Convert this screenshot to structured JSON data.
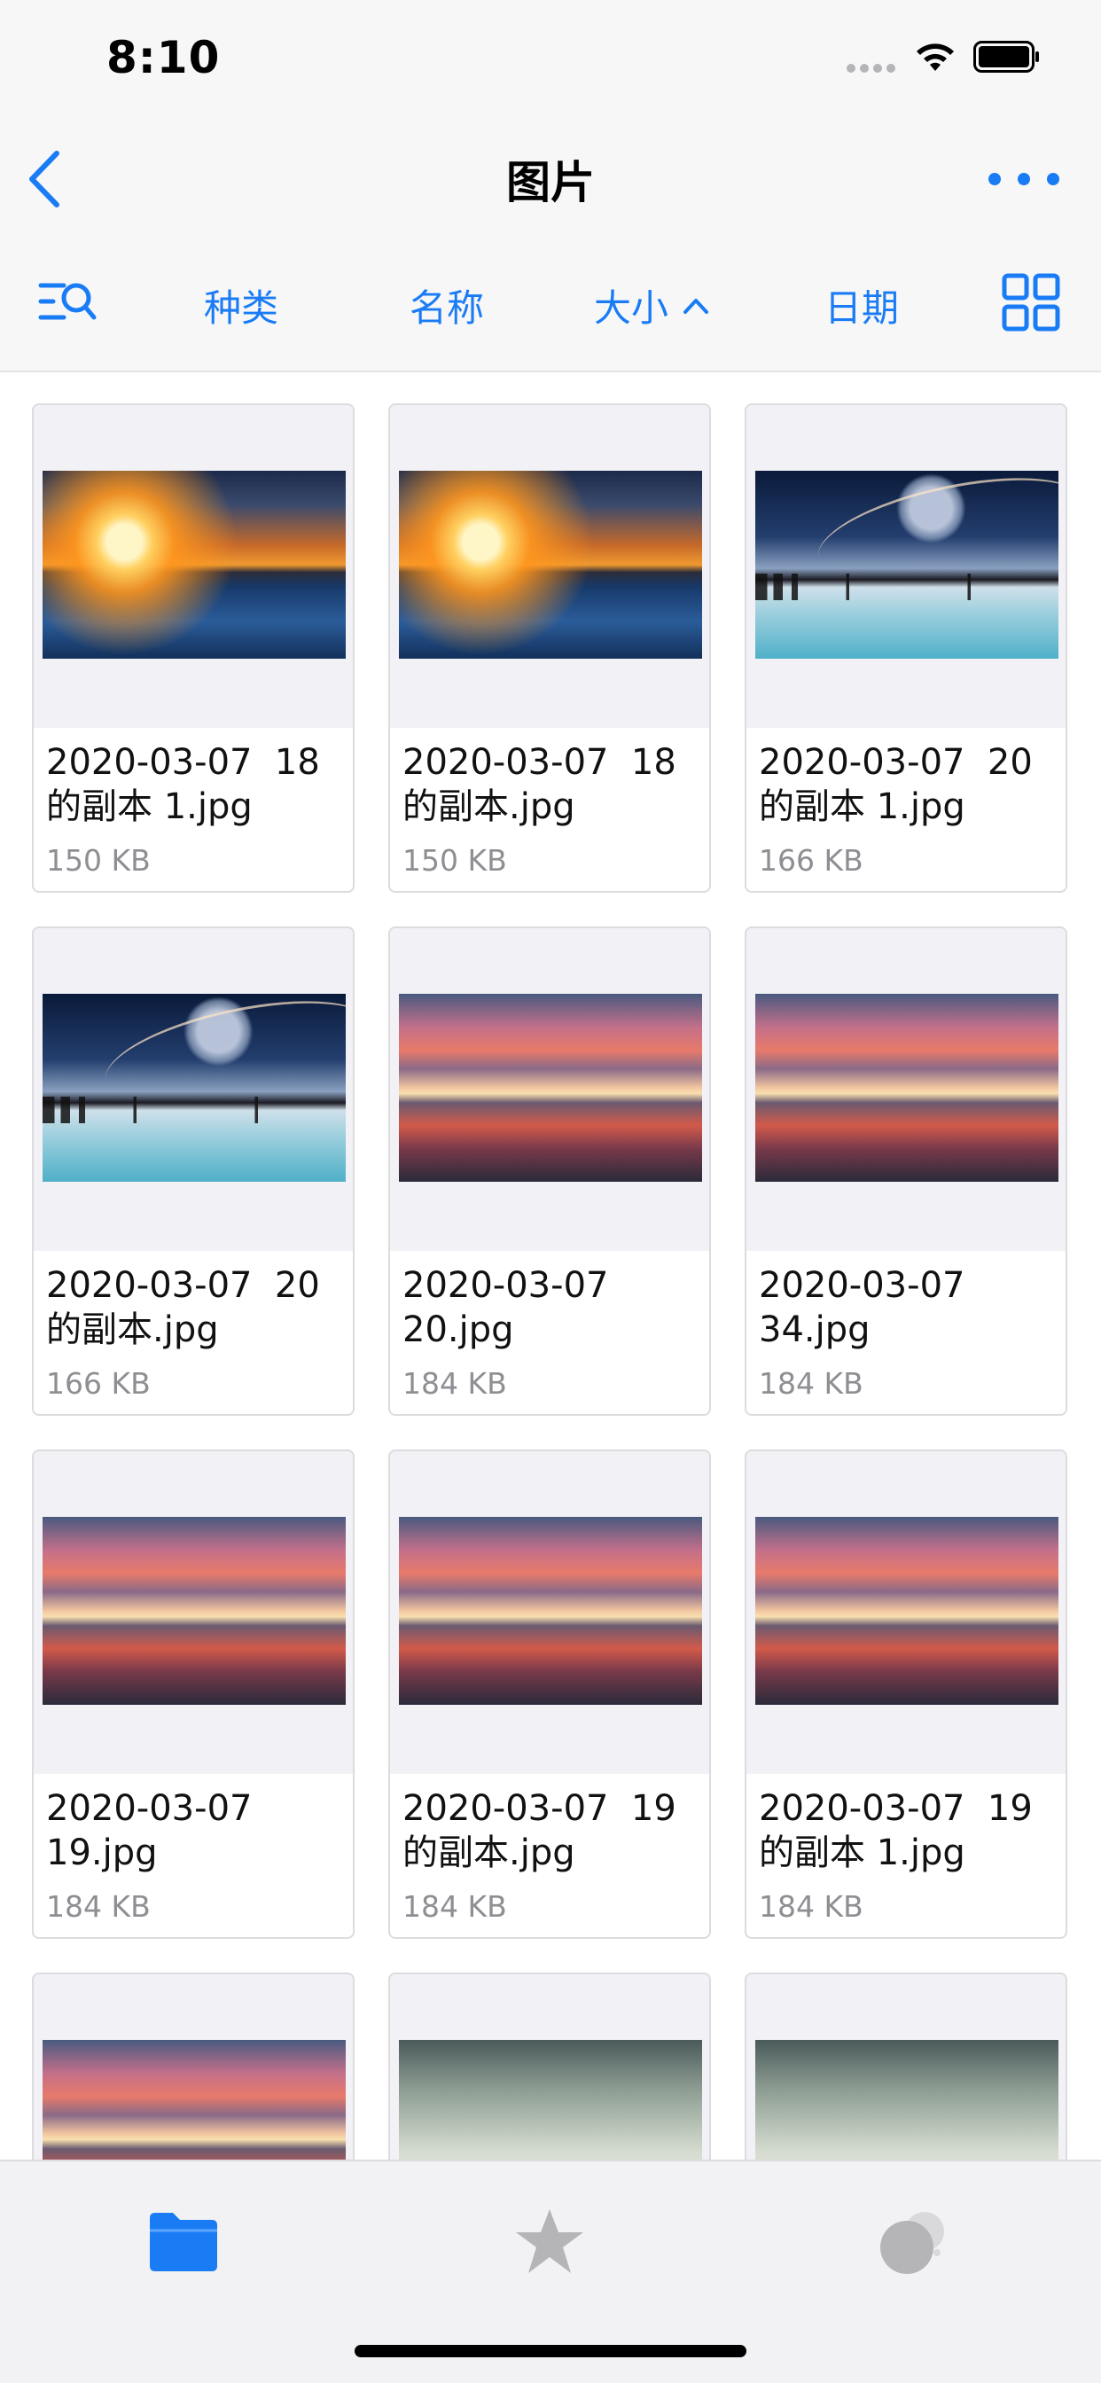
{
  "status_bar": {
    "time": "8:10"
  },
  "nav": {
    "title": "图片"
  },
  "sort_bar": {
    "options": [
      {
        "label": "种类"
      },
      {
        "label": "名称"
      },
      {
        "label": "大小"
      },
      {
        "label": "日期"
      }
    ],
    "active": "大小",
    "active_direction": "ascending"
  },
  "files": [
    {
      "name": "2020-03-07  18\n的副本 1.jpg",
      "size": "150 KB",
      "thumb": "sunset-orange"
    },
    {
      "name": "2020-03-07  18\n的副本.jpg",
      "size": "150 KB",
      "thumb": "sunset-orange"
    },
    {
      "name": "2020-03-07  20\n的副本 1.jpg",
      "size": "166 KB",
      "thumb": "planet-city"
    },
    {
      "name": "2020-03-07  20\n的副本.jpg",
      "size": "166 KB",
      "thumb": "planet-city"
    },
    {
      "name": "2020-03-07\n20.jpg",
      "size": "184 KB",
      "thumb": "pink-sunset"
    },
    {
      "name": "2020-03-07\n34.jpg",
      "size": "184 KB",
      "thumb": "pink-sunset"
    },
    {
      "name": "2020-03-07\n19.jpg",
      "size": "184 KB",
      "thumb": "pink-sunset"
    },
    {
      "name": "2020-03-07  19\n的副本.jpg",
      "size": "184 KB",
      "thumb": "pink-sunset"
    },
    {
      "name": "2020-03-07  19\n的副本 1.jpg",
      "size": "184 KB",
      "thumb": "pink-sunset"
    },
    {
      "name": "",
      "size": "",
      "thumb": "pink-sunset"
    },
    {
      "name": "",
      "size": "",
      "thumb": "foggy-city"
    },
    {
      "name": "",
      "size": "",
      "thumb": "foggy-city"
    }
  ],
  "tab_bar": {
    "tabs": [
      {
        "icon": "folder-icon",
        "active": true
      },
      {
        "icon": "star-icon",
        "active": false
      },
      {
        "icon": "shared-icon",
        "active": false
      }
    ]
  },
  "colors": {
    "accent": "#1a7cf5",
    "secondary_text": "#8e8e93",
    "inactive_icon": "#b5b5b8"
  }
}
